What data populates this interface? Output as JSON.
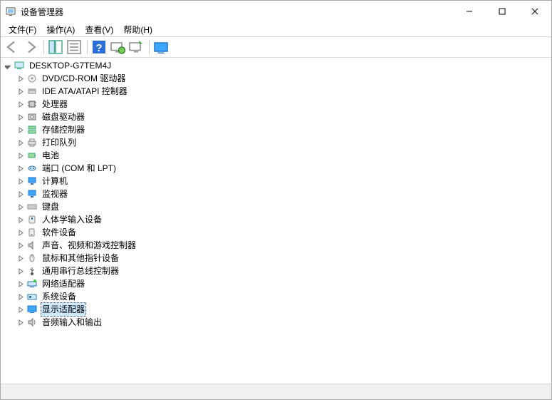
{
  "window": {
    "title": "设备管理器"
  },
  "menu": {
    "file": "文件(F)",
    "action": "操作(A)",
    "view": "查看(V)",
    "help": "帮助(H)"
  },
  "tree": {
    "root": {
      "label": "DESKTOP-G7TEM4J",
      "icon": "computer",
      "expanded": true,
      "children": [
        {
          "label": "DVD/CD-ROM 驱动器",
          "icon": "disc"
        },
        {
          "label": "IDE ATA/ATAPI 控制器",
          "icon": "ide"
        },
        {
          "label": "处理器",
          "icon": "cpu"
        },
        {
          "label": "磁盘驱动器",
          "icon": "disk"
        },
        {
          "label": "存储控制器",
          "icon": "storage"
        },
        {
          "label": "打印队列",
          "icon": "printer"
        },
        {
          "label": "电池",
          "icon": "battery"
        },
        {
          "label": "端口 (COM 和 LPT)",
          "icon": "port"
        },
        {
          "label": "计算机",
          "icon": "monitor"
        },
        {
          "label": "监视器",
          "icon": "monitor"
        },
        {
          "label": "键盘",
          "icon": "keyboard"
        },
        {
          "label": "人体学输入设备",
          "icon": "hid"
        },
        {
          "label": "软件设备",
          "icon": "software"
        },
        {
          "label": "声音、视频和游戏控制器",
          "icon": "sound"
        },
        {
          "label": "鼠标和其他指针设备",
          "icon": "mouse"
        },
        {
          "label": "通用串行总线控制器",
          "icon": "usb"
        },
        {
          "label": "网络适配器",
          "icon": "network"
        },
        {
          "label": "系统设备",
          "icon": "system"
        },
        {
          "label": "显示适配器",
          "icon": "display",
          "selected": true
        },
        {
          "label": "音频输入和输出",
          "icon": "audio"
        }
      ]
    }
  }
}
